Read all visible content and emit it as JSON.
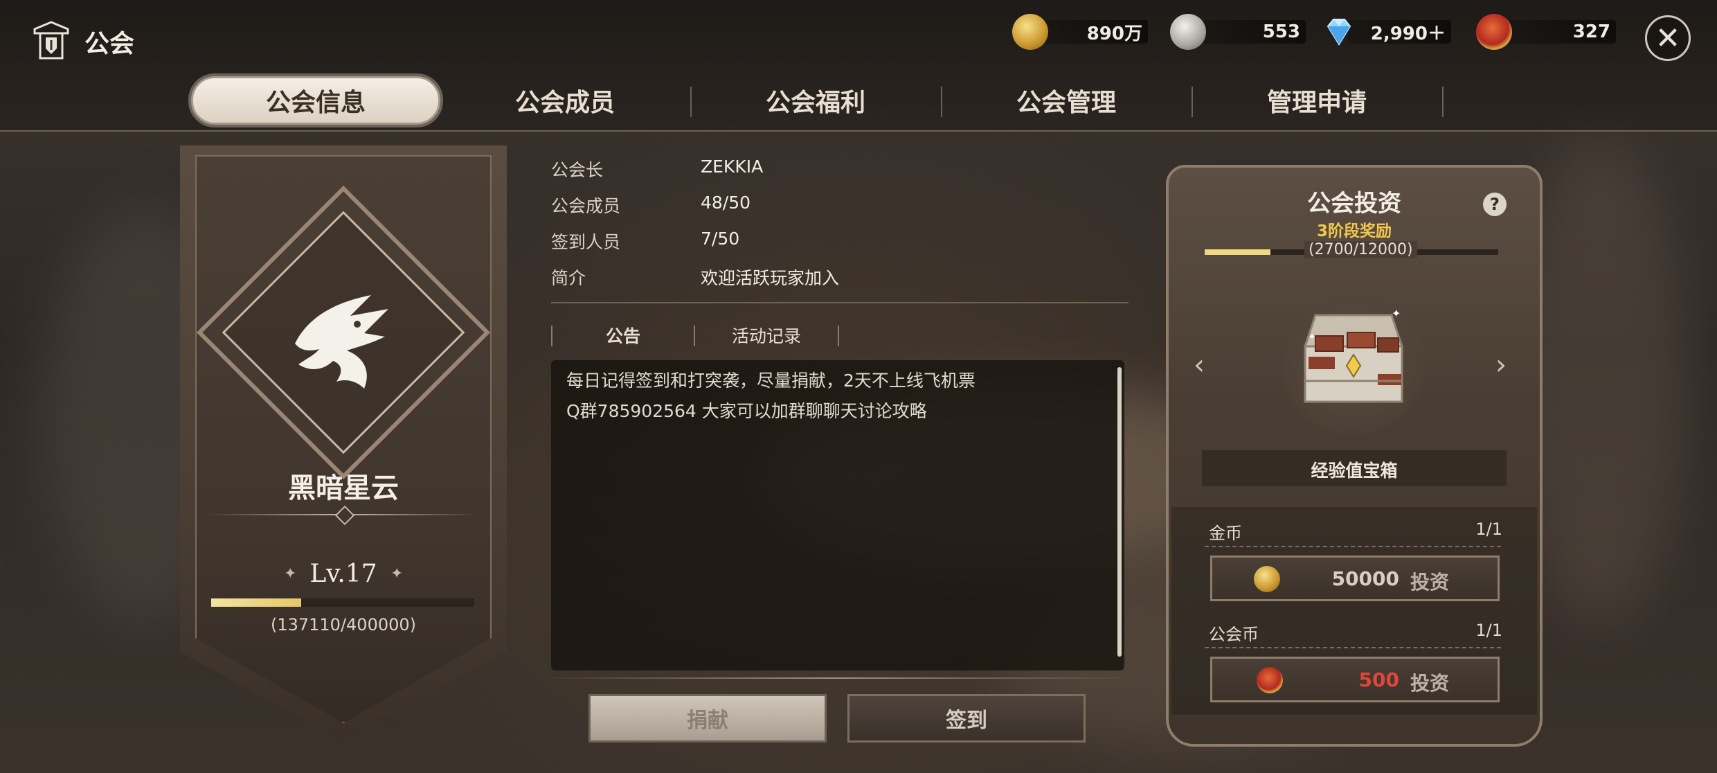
{
  "header": {
    "title": "公会",
    "close_icon": "close-icon"
  },
  "currencies": [
    {
      "icon": "gold-coin-icon",
      "value": "890万",
      "color": "#d9b24a"
    },
    {
      "icon": "silver-coin-icon",
      "value": "553",
      "color": "#b8b4ad"
    },
    {
      "icon": "diamond-icon",
      "value": "2,990＋",
      "color": "#7ecbf2"
    },
    {
      "icon": "guild-coin-icon",
      "value": "327",
      "color": "#c8362a"
    }
  ],
  "tabs": [
    "公会信息",
    "公会成员",
    "公会福利",
    "公会管理",
    "管理申请"
  ],
  "active_tab": "公会信息",
  "guild": {
    "name": "黑暗星云",
    "emblem_icon": "dragon-emblem-icon",
    "level": "Lv.17",
    "exp_progress_text": "(137110/400000)",
    "exp_fraction": 0.343
  },
  "info": [
    {
      "label": "公会长",
      "value": "ZEKKIA"
    },
    {
      "label": "公会成员",
      "value": "48/50"
    },
    {
      "label": "签到人员",
      "value": "7/50"
    },
    {
      "label": "简介",
      "value": "欢迎活跃玩家加入"
    }
  ],
  "subtabs": [
    "公告",
    "活动记录"
  ],
  "active_subtab": "公告",
  "notice_lines": [
    "每日记得签到和打突袭，尽量捐献，2天不上线飞机票",
    "Q群785902564 大家可以加群聊聊天讨论攻略"
  ],
  "buttons": {
    "donate": "捐献",
    "sign_in": "签到"
  },
  "invest": {
    "title": "公会投资",
    "stage": "3阶段奖励",
    "progress_text": "(2700/12000)",
    "progress_fraction": 0.225,
    "reward_name": "经验值宝箱",
    "reward_icon": "treasure-chest-icon",
    "help_icon": "?",
    "options": [
      {
        "label": "金币",
        "count": "1/1",
        "icon": "gold-coin-icon",
        "amount": "50000",
        "action": "投资",
        "amount_color": "#d8cfc3"
      },
      {
        "label": "公会币",
        "count": "1/1",
        "icon": "guild-coin-icon",
        "amount": "500",
        "action": "投资",
        "amount_color": "#e0473a"
      }
    ]
  }
}
